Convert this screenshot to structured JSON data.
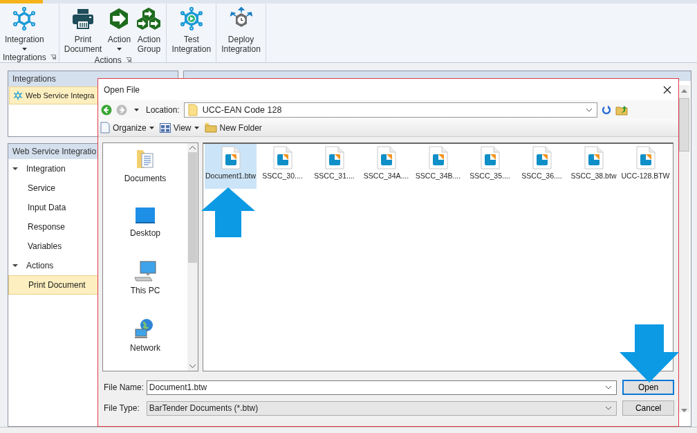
{
  "ribbon": {
    "groups": [
      {
        "label": "Integrations",
        "launcher": true,
        "buttons": [
          {
            "kind": "integration",
            "lines": [
              "Integration"
            ],
            "dropdown": true
          }
        ]
      },
      {
        "label": "Actions",
        "launcher": true,
        "buttons": [
          {
            "kind": "printer",
            "lines": [
              "Print",
              "Document"
            ],
            "dropdown": false
          },
          {
            "kind": "action",
            "lines": [
              "Action"
            ],
            "dropdown": true
          },
          {
            "kind": "action-group",
            "lines": [
              "Action",
              "Group"
            ],
            "dropdown": false
          }
        ]
      },
      {
        "buttons": [
          {
            "kind": "test",
            "lines": [
              "Test",
              "Integration"
            ],
            "dropdown": false
          }
        ]
      },
      {
        "buttons": [
          {
            "kind": "deploy",
            "lines": [
              "Deploy",
              "Integration"
            ],
            "dropdown": false
          }
        ]
      }
    ]
  },
  "integrations_panel": {
    "title": "Integrations",
    "items": [
      {
        "label": "Web Service Integra",
        "selected": true
      }
    ]
  },
  "tree_panel": {
    "title": "Web Service Integratio",
    "items": [
      {
        "label": "Integration",
        "expanded": true,
        "children": [
          {
            "label": "Service",
            "selected": false
          },
          {
            "label": "Input Data",
            "selected": false
          },
          {
            "label": "Response",
            "selected": false
          },
          {
            "label": "Variables",
            "selected": false
          }
        ]
      },
      {
        "label": "Actions",
        "expanded": true,
        "children": [
          {
            "label": "Print Document",
            "selected": true
          }
        ]
      }
    ]
  },
  "dialog": {
    "title": "Open File",
    "back_enabled": true,
    "forward_enabled": false,
    "location_label": "Location:",
    "location": "UCC-EAN Code 128",
    "toolbar": [
      {
        "label": "Organize",
        "kind": "page",
        "dropdown": true
      },
      {
        "label": "View",
        "kind": "grid",
        "dropdown": true
      },
      {
        "label": "New Folder",
        "kind": "folder",
        "dropdown": false
      }
    ],
    "places": [
      {
        "label": "Documents",
        "kind": "documents"
      },
      {
        "label": "Desktop",
        "kind": "desktop"
      },
      {
        "label": "This PC",
        "kind": "pc"
      },
      {
        "label": "Network",
        "kind": "network"
      }
    ],
    "files": [
      {
        "name": "Document1.btw",
        "selected": true
      },
      {
        "name": "SSCC_30....",
        "selected": false
      },
      {
        "name": "SSCC_31....",
        "selected": false
      },
      {
        "name": "SSCC_34A....",
        "selected": false
      },
      {
        "name": "SSCC_34B....",
        "selected": false
      },
      {
        "name": "SSCC_35....",
        "selected": false
      },
      {
        "name": "SSCC_36....",
        "selected": false
      },
      {
        "name": "SSCC_38.btw",
        "selected": false
      },
      {
        "name": "UCC-128.BTW",
        "selected": false
      }
    ],
    "file_name_label": "File Name:",
    "file_name": "Document1.btw",
    "file_type_label": "File Type:",
    "file_type": "BarTender Documents (*.btw)",
    "buttons": [
      {
        "label": "Open",
        "default": true
      },
      {
        "label": "Cancel",
        "default": false
      }
    ]
  }
}
